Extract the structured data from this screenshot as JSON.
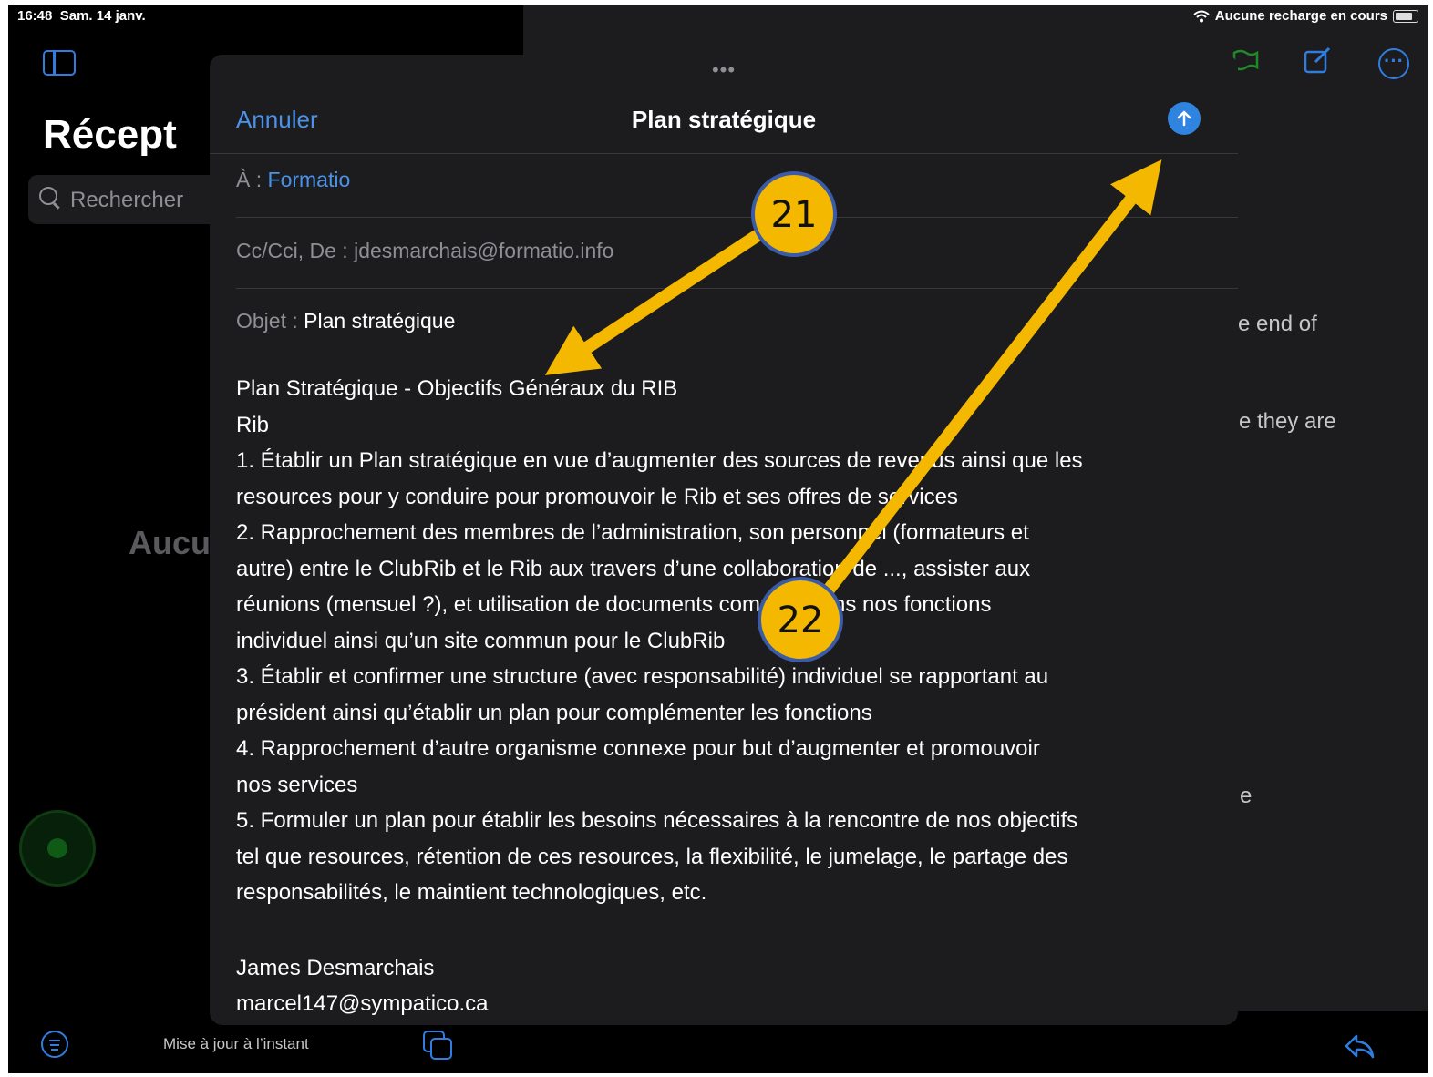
{
  "status": {
    "time": "16:48",
    "date": "Sam. 14 janv.",
    "charging": "Aucune recharge en cours"
  },
  "sidebar": {
    "title": "Récept",
    "search_placeholder": "Rechercher",
    "empty": "Aucu"
  },
  "footer": {
    "updated": "Mise à jour à l’instant"
  },
  "reader_fragments": [
    "e end of",
    "e they are",
    "e"
  ],
  "compose": {
    "cancel": "Annuler",
    "title": "Plan stratégique",
    "to_label": "À :",
    "to_value": "Formatio",
    "cc_label": "Cc/Cci, De :",
    "cc_value": "jdesmarchais@formatio.info",
    "subject_label": "Objet :",
    "subject_value": "Plan stratégique",
    "body": [
      "Plan Stratégique - Objectifs Généraux du RIB",
      "Rib",
      "1. Établir un Plan stratégique en vue d’augmenter des sources de revenus ainsi que les",
      "resources pour y conduire pour promouvoir le Rib et ses offres de services",
      "2. Rapprochement des membres de l’administration, son personnel (formateurs et",
      "autre) entre le ClubRib et le Rib aux travers d’une collaboration de ..., assister aux",
      "réunions (mensuel ?), et utilisation de documents commun dans nos fonctions",
      "individuel ainsi qu’un site commun pour le ClubRib",
      "3. Établir et confirmer une structure (avec responsabilité) individuel se rapportant au",
      "président ainsi qu’établir un plan pour complémenter les fonctions",
      "4. Rapprochement d’autre organisme connexe pour but d’augmenter et promouvoir",
      "nos services",
      "5. Formuler un plan pour établir les besoins nécessaires à la rencontre de nos objectifs",
      "tel que resources, rétention de ces resources, la flexibilité, le jumelage, le partage des",
      "responsabilités, le maintient technologiques, etc."
    ],
    "signature_name": "James Desmarchais",
    "signature_email": "marcel147@sympatico.ca"
  },
  "annotations": {
    "step_a": "21",
    "step_b": "22"
  },
  "colors": {
    "accent": "#2f84e0",
    "callout": "#f5b800",
    "callout_border": "#3a5ba8"
  }
}
